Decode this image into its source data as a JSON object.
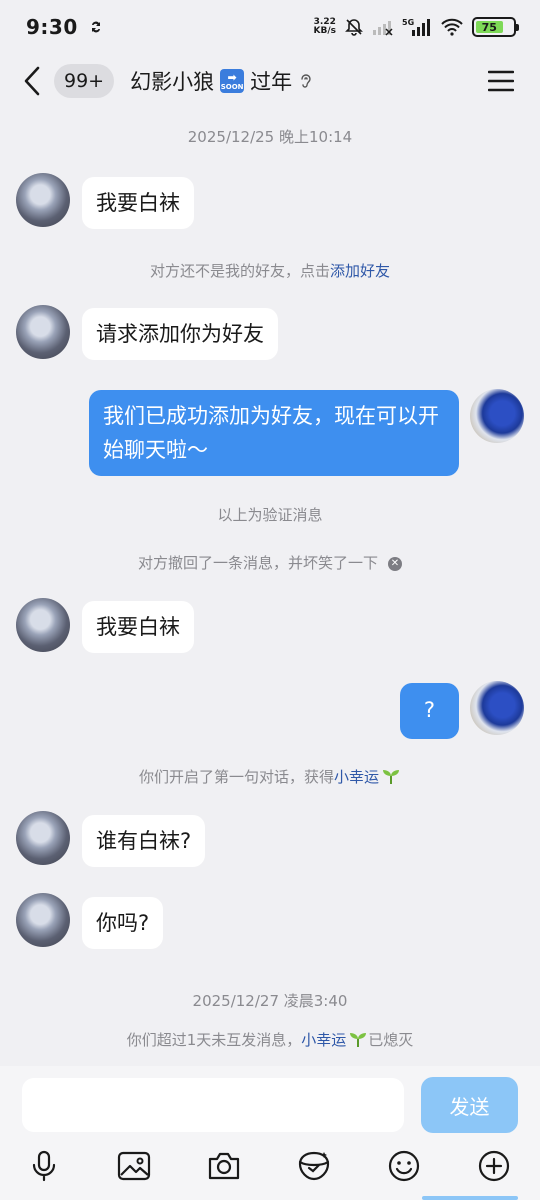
{
  "status_bar": {
    "time": "9:30",
    "net_speed_value": "3.22",
    "net_speed_unit": "KB/s",
    "network": "5G",
    "battery": "75"
  },
  "header": {
    "unread_count": "99+",
    "title_part1": "幻影小狼",
    "title_part2": "过年",
    "soon_icon_text": "SOON"
  },
  "messages": {
    "ts1": "2025/12/25 晚上10:14",
    "m1": "我要白袜",
    "sys1_prefix": "对方还不是我的好友，点击",
    "sys1_link": "添加好友",
    "m2": "请求添加你为好友",
    "m3": "我们已成功添加为好友，现在可以开始聊天啦～",
    "sys2": "以上为验证消息",
    "sys3": "对方撤回了一条消息，并坏笑了一下",
    "m4": "我要白袜",
    "m5": "?",
    "sys4_prefix": "你们开启了第一句对话，获得",
    "sys4_link": "小幸运",
    "m6": "谁有白袜?",
    "m7": "你吗?",
    "ts2": "2025/12/27 凌晨3:40",
    "sys5_prefix": "你们超过1天未互发消息，",
    "sys5_link": "小幸运",
    "sys5_suffix": "已熄灭"
  },
  "composer": {
    "placeholder": "",
    "send_label": "发送"
  },
  "toolbar_icons": [
    "mic-icon",
    "image-icon",
    "camera-icon",
    "red-packet-icon",
    "emoji-icon",
    "plus-icon"
  ],
  "colors": {
    "outgoing_bubble": "#3e8fef",
    "incoming_bubble": "#ffffff",
    "link": "#2f58a8",
    "send_button": "#8cc6f7",
    "background": "#f0f0f3"
  }
}
